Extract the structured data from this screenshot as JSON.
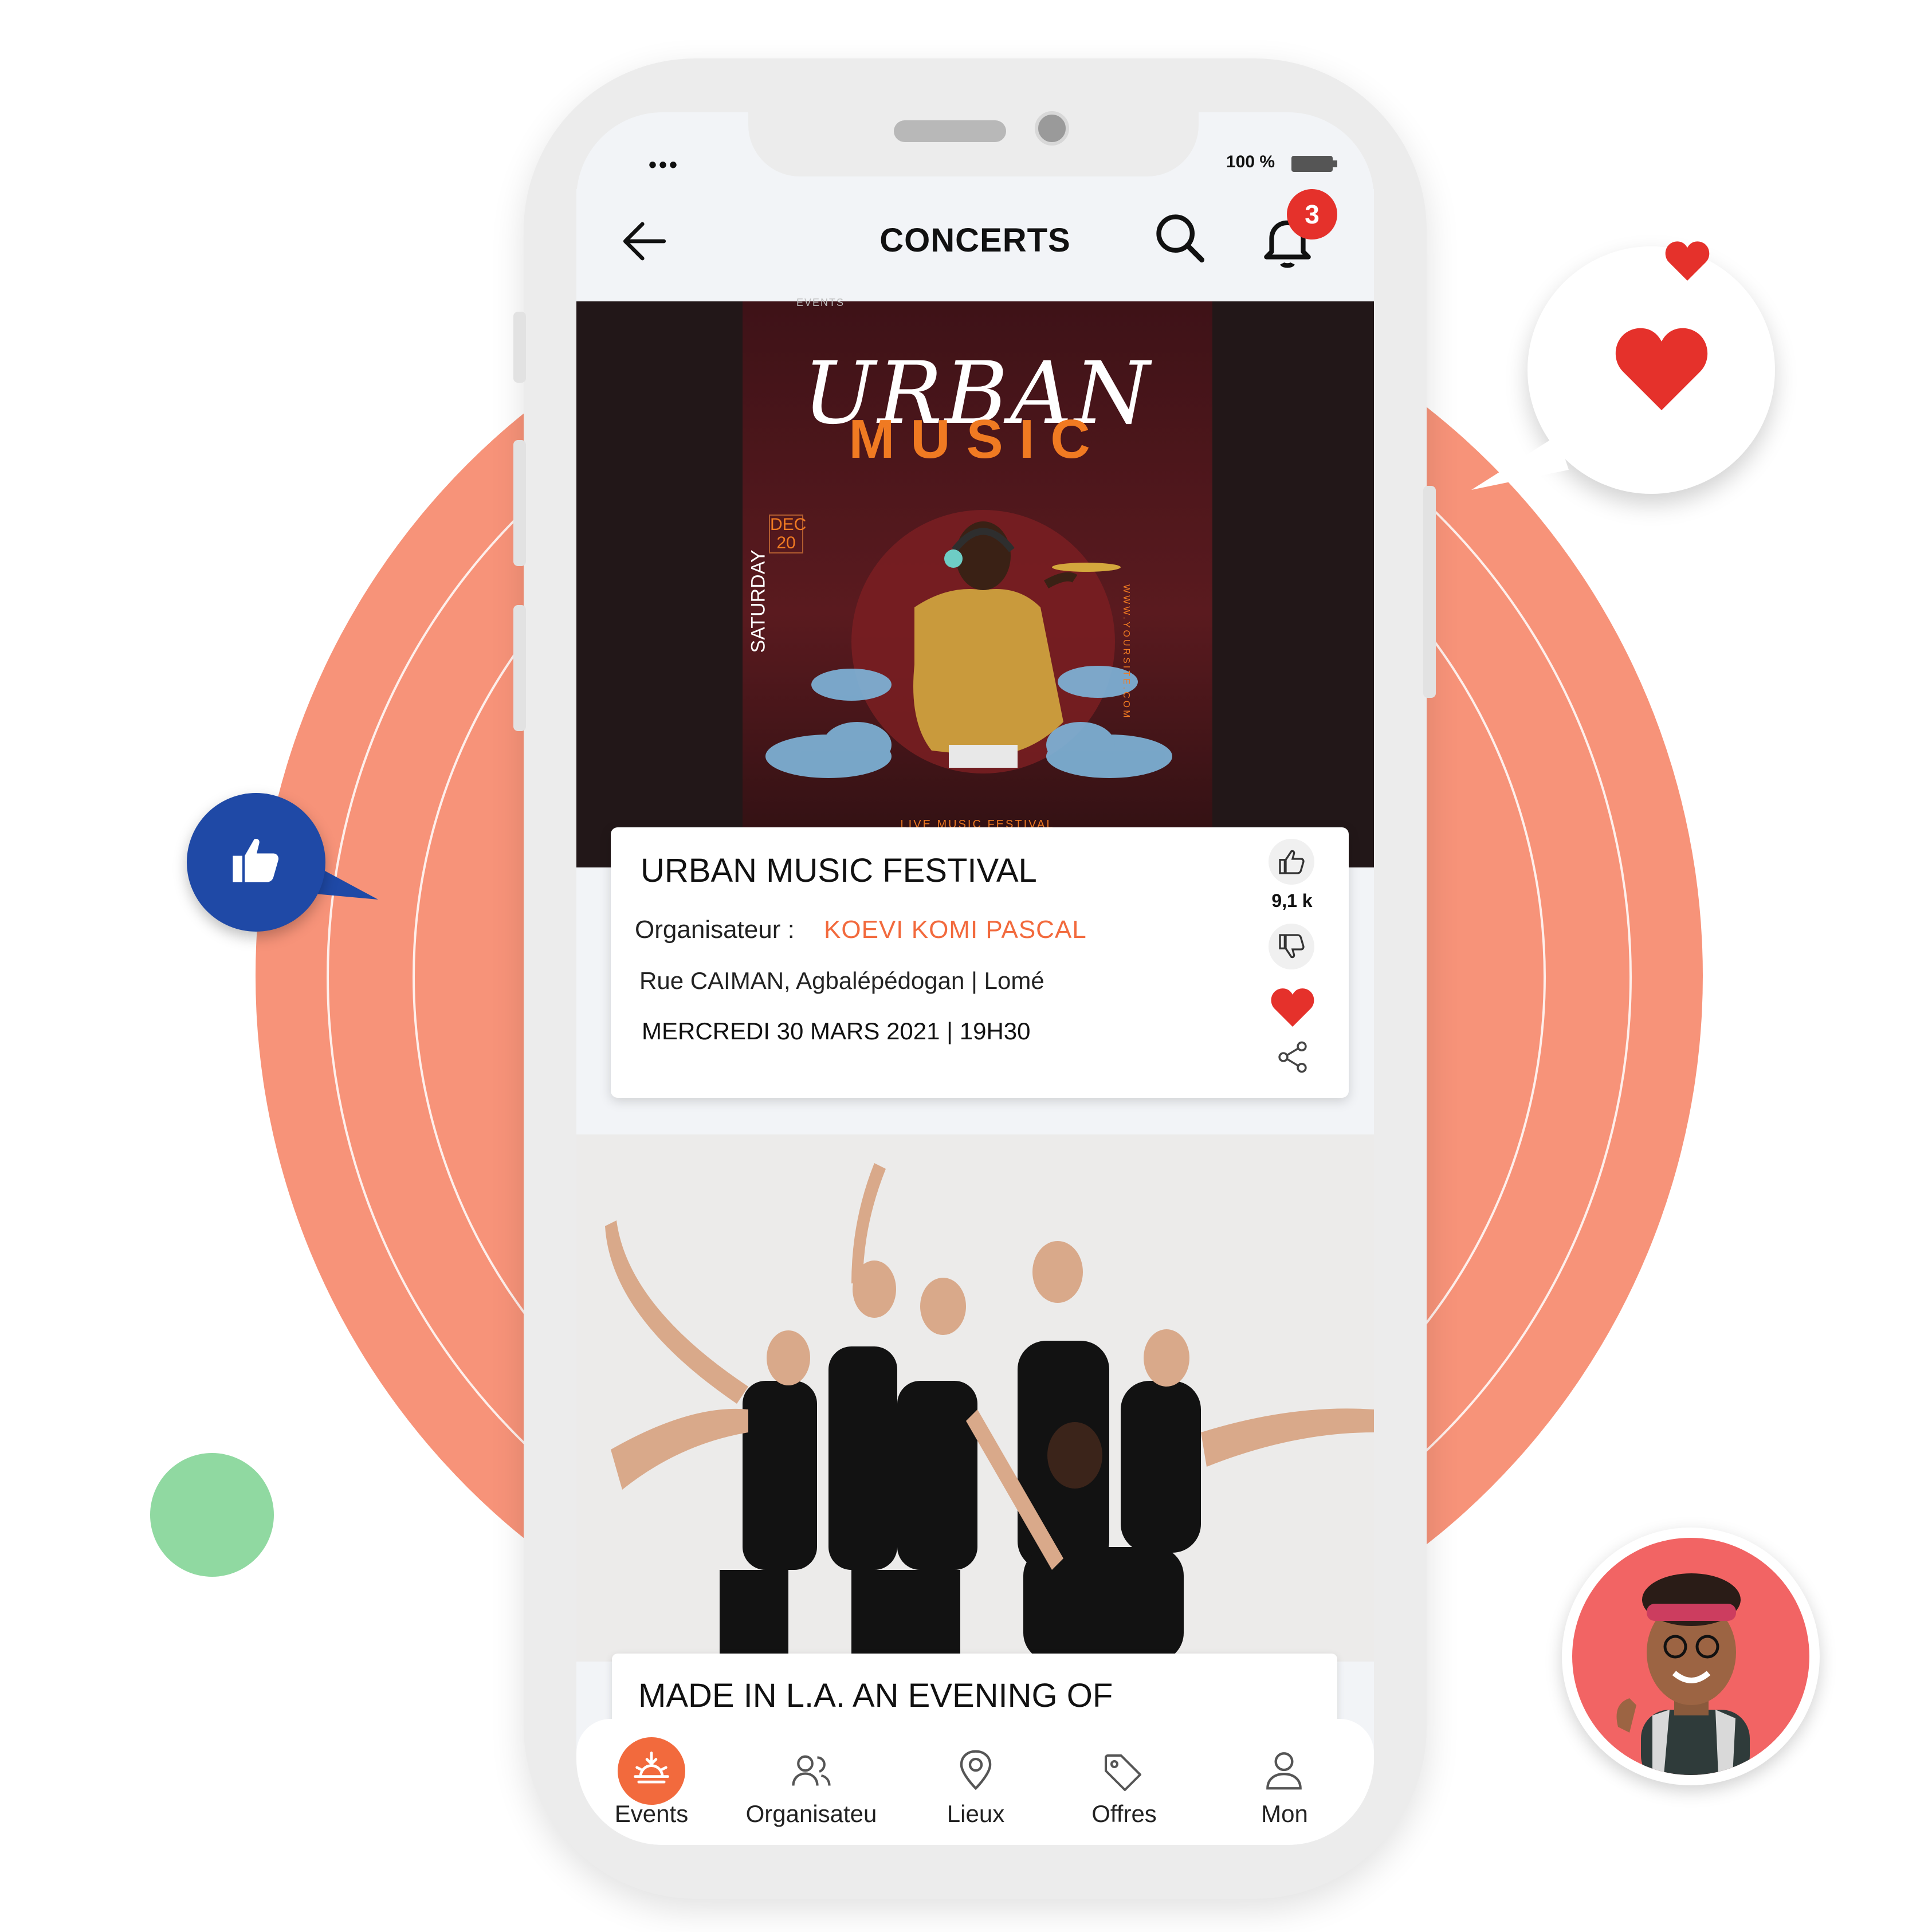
{
  "status_bar": {
    "dots": "•••",
    "battery": "100 %"
  },
  "header": {
    "title": "CONCERTS",
    "notification_count": "3"
  },
  "events": [
    {
      "poster_title": "URBAN",
      "poster_subtitle": "MUSIC",
      "poster_month": "DEC",
      "poster_day_num": "20",
      "poster_weekday": "SATURDAY",
      "poster_site": "WWW.YOURSITE.COM",
      "poster_brand": "EVENTS",
      "poster_footer": "LIVE MUSIC FESTIVAL",
      "title": "URBAN MUSIC FESTIVAL",
      "organizer_label": "Organisateur :",
      "organizer_name": "KOEVI KOMI PASCAL",
      "address": "Rue CAIMAN, Agbalépédogan | Lomé",
      "datetime": "MERCREDI  30 MARS 2021 | 19H30",
      "likes": "9,1 k"
    },
    {
      "title": "MADE IN L.A. AN EVENING OF"
    }
  ],
  "bottom_nav": [
    {
      "label": "Events",
      "icon": "sunrise-icon",
      "active": true
    },
    {
      "label": "Organisateu",
      "icon": "users-icon",
      "active": false
    },
    {
      "label": "Lieux",
      "icon": "location-pin-icon",
      "active": false
    },
    {
      "label": "Offres",
      "icon": "tag-icon",
      "active": false
    },
    {
      "label": "Mon",
      "icon": "user-icon",
      "active": false
    }
  ],
  "colors": {
    "accent": "#f26a3d",
    "background_circle": "#f79379",
    "like_bubble": "#1f49a6",
    "heart": "#e5312b",
    "green_dot": "#90d9a1"
  }
}
